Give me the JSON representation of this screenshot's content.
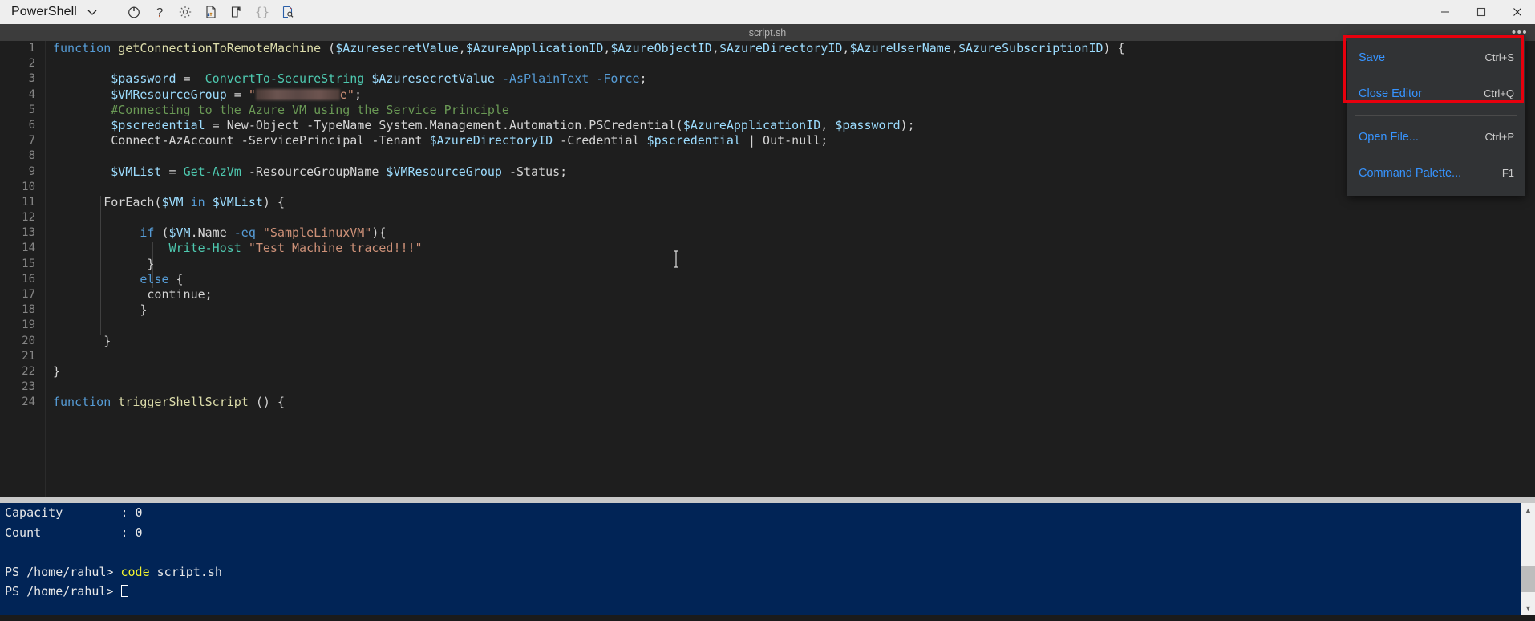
{
  "window": {
    "shell_label": "PowerShell",
    "shell_dropdown_icon": "chevron-down-icon",
    "toolbar_icons": [
      {
        "name": "power-icon",
        "title": "Power"
      },
      {
        "name": "help-icon",
        "title": "Help"
      },
      {
        "name": "settings-gear-icon",
        "title": "Settings"
      },
      {
        "name": "upload-download-file-icon",
        "title": "Upload/Download files"
      },
      {
        "name": "new-file-icon",
        "title": "New file"
      },
      {
        "name": "curly-braces-icon",
        "title": "Code braces"
      },
      {
        "name": "editor-preview-icon",
        "title": "Open editor"
      }
    ],
    "controls": [
      {
        "name": "minimize-button",
        "glyph": "minimize"
      },
      {
        "name": "maximize-button",
        "glyph": "maximize"
      },
      {
        "name": "close-button",
        "glyph": "close"
      }
    ]
  },
  "editor": {
    "tab_title": "script.sh",
    "more_actions_label": "•••",
    "line_count_visible": 24,
    "lines": [
      {
        "n": "1",
        "tokens": [
          {
            "c": "kw",
            "t": "function "
          },
          {
            "c": "fn",
            "t": "getConnectionToRemoteMachine"
          },
          {
            "c": "def",
            "t": " ("
          },
          {
            "c": "var",
            "t": "$AzuresecretValue"
          },
          {
            "c": "def",
            "t": ","
          },
          {
            "c": "var",
            "t": "$AzureApplicationID"
          },
          {
            "c": "def",
            "t": ","
          },
          {
            "c": "var",
            "t": "$AzureObjectID"
          },
          {
            "c": "def",
            "t": ","
          },
          {
            "c": "var",
            "t": "$AzureDirectoryID"
          },
          {
            "c": "def",
            "t": ","
          },
          {
            "c": "var",
            "t": "$AzureUserName"
          },
          {
            "c": "def",
            "t": ","
          },
          {
            "c": "var",
            "t": "$AzureSubscriptionID"
          },
          {
            "c": "def",
            "t": ") {"
          }
        ]
      },
      {
        "n": "2",
        "tokens": []
      },
      {
        "n": "3",
        "tokens": [
          {
            "c": "def",
            "t": "        "
          },
          {
            "c": "var",
            "t": "$password"
          },
          {
            "c": "def",
            "t": " =  "
          },
          {
            "c": "cmd",
            "t": "ConvertTo-SecureString"
          },
          {
            "c": "def",
            "t": " "
          },
          {
            "c": "var",
            "t": "$AzuresecretValue"
          },
          {
            "c": "def",
            "t": " "
          },
          {
            "c": "kw",
            "t": "-AsPlainText"
          },
          {
            "c": "def",
            "t": " "
          },
          {
            "c": "kw",
            "t": "-Force"
          },
          {
            "c": "def",
            "t": ";"
          }
        ]
      },
      {
        "n": "4",
        "tokens": [
          {
            "c": "def",
            "t": "        "
          },
          {
            "c": "var",
            "t": "$VMResourceGroup"
          },
          {
            "c": "def",
            "t": " = "
          },
          {
            "c": "str",
            "t": "\""
          },
          {
            "c": "redact",
            "t": ""
          },
          {
            "c": "str",
            "t": "e\""
          },
          {
            "c": "def",
            "t": ";"
          }
        ]
      },
      {
        "n": "5",
        "tokens": [
          {
            "c": "def",
            "t": "        "
          },
          {
            "c": "com",
            "t": "#Connecting to the Azure VM using the Service Principle"
          }
        ]
      },
      {
        "n": "6",
        "tokens": [
          {
            "c": "def",
            "t": "        "
          },
          {
            "c": "var",
            "t": "$pscredential"
          },
          {
            "c": "def",
            "t": " = New-Object -TypeName System.Management.Automation.PSCredential("
          },
          {
            "c": "var",
            "t": "$AzureApplicationID"
          },
          {
            "c": "def",
            "t": ", "
          },
          {
            "c": "var",
            "t": "$password"
          },
          {
            "c": "def",
            "t": ");"
          }
        ]
      },
      {
        "n": "7",
        "tokens": [
          {
            "c": "def",
            "t": "        Connect-AzAccount -ServicePrincipal -Tenant "
          },
          {
            "c": "var",
            "t": "$AzureDirectoryID"
          },
          {
            "c": "def",
            "t": " -Credential "
          },
          {
            "c": "var",
            "t": "$pscredential"
          },
          {
            "c": "def",
            "t": " | Out-null;"
          }
        ]
      },
      {
        "n": "8",
        "tokens": []
      },
      {
        "n": "9",
        "tokens": [
          {
            "c": "def",
            "t": "        "
          },
          {
            "c": "var",
            "t": "$VMList"
          },
          {
            "c": "def",
            "t": " = "
          },
          {
            "c": "cmd",
            "t": "Get-AzVm"
          },
          {
            "c": "def",
            "t": " -ResourceGroupName "
          },
          {
            "c": "var",
            "t": "$VMResourceGroup"
          },
          {
            "c": "def",
            "t": " -Status;"
          }
        ]
      },
      {
        "n": "10",
        "tokens": []
      },
      {
        "n": "11",
        "tokens": [
          {
            "c": "def",
            "t": "       ForEach("
          },
          {
            "c": "var",
            "t": "$VM"
          },
          {
            "c": "def",
            "t": " "
          },
          {
            "c": "kw",
            "t": "in"
          },
          {
            "c": "def",
            "t": " "
          },
          {
            "c": "var",
            "t": "$VMList"
          },
          {
            "c": "def",
            "t": ") {"
          }
        ]
      },
      {
        "n": "12",
        "tokens": []
      },
      {
        "n": "13",
        "tokens": [
          {
            "c": "def",
            "t": "            "
          },
          {
            "c": "kw",
            "t": "if"
          },
          {
            "c": "def",
            "t": " ("
          },
          {
            "c": "var",
            "t": "$VM"
          },
          {
            "c": "def",
            "t": ".Name "
          },
          {
            "c": "kw",
            "t": "-eq"
          },
          {
            "c": "def",
            "t": " "
          },
          {
            "c": "str",
            "t": "\"SampleLinuxVM\""
          },
          {
            "c": "def",
            "t": "){"
          }
        ]
      },
      {
        "n": "14",
        "tokens": [
          {
            "c": "def",
            "t": "                "
          },
          {
            "c": "cmd",
            "t": "Write-Host"
          },
          {
            "c": "def",
            "t": " "
          },
          {
            "c": "str",
            "t": "\"Test Machine traced!!!\""
          }
        ]
      },
      {
        "n": "15",
        "tokens": [
          {
            "c": "def",
            "t": "             }"
          }
        ]
      },
      {
        "n": "16",
        "tokens": [
          {
            "c": "def",
            "t": "            "
          },
          {
            "c": "kw",
            "t": "else"
          },
          {
            "c": "def",
            "t": " {"
          }
        ]
      },
      {
        "n": "17",
        "tokens": [
          {
            "c": "def",
            "t": "             continue;"
          }
        ]
      },
      {
        "n": "18",
        "tokens": [
          {
            "c": "def",
            "t": "            }"
          }
        ]
      },
      {
        "n": "19",
        "tokens": []
      },
      {
        "n": "20",
        "tokens": [
          {
            "c": "def",
            "t": "       }"
          }
        ]
      },
      {
        "n": "21",
        "tokens": []
      },
      {
        "n": "22",
        "tokens": [
          {
            "c": "def",
            "t": "}"
          }
        ]
      },
      {
        "n": "23",
        "tokens": []
      },
      {
        "n": "24",
        "tokens": [
          {
            "c": "kw",
            "t": "function "
          },
          {
            "c": "fn",
            "t": "triggerShellScript"
          },
          {
            "c": "def",
            "t": " () {"
          }
        ]
      }
    ]
  },
  "context_menu": {
    "items": [
      {
        "label": "Save",
        "shortcut": "Ctrl+S",
        "highlighted": true
      },
      {
        "label": "Close Editor",
        "shortcut": "Ctrl+Q",
        "highlighted": true
      },
      {
        "label": "Open File...",
        "shortcut": "Ctrl+P",
        "highlighted": false
      },
      {
        "label": "Command Palette...",
        "shortcut": "F1",
        "highlighted": false
      }
    ],
    "annotation_color": "#e8000d"
  },
  "terminal": {
    "lines": [
      [
        {
          "c": "white",
          "t": "Capacity        : 0"
        }
      ],
      [
        {
          "c": "white",
          "t": "Count           : 0"
        }
      ],
      [],
      [
        {
          "c": "white",
          "t": "PS /home/rahul> "
        },
        {
          "c": "yellow",
          "t": "code"
        },
        {
          "c": "white",
          "t": " script.sh"
        }
      ],
      [
        {
          "c": "white",
          "t": "PS /home/rahul> "
        },
        {
          "c": "cursor",
          "t": ""
        }
      ]
    ],
    "background_color": "#012456",
    "scrollbar": {
      "up_arrow": "▲",
      "down_arrow": "▼"
    }
  }
}
